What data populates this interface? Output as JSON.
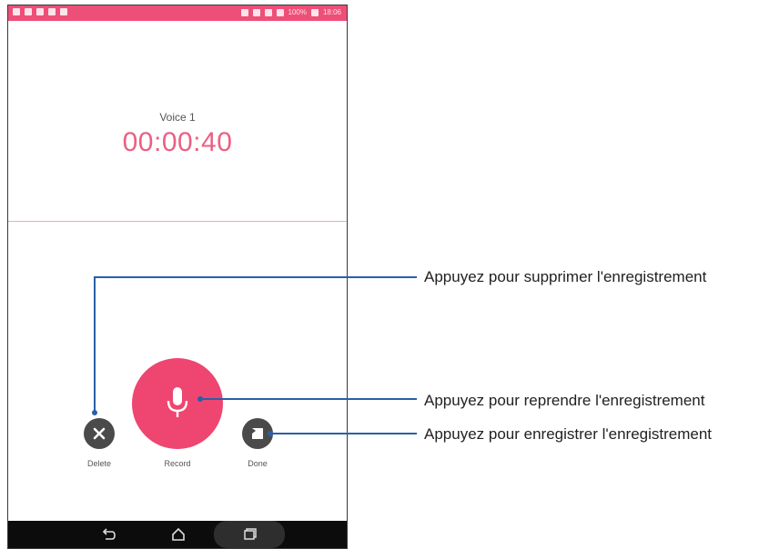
{
  "statusbar": {
    "battery": "100%",
    "time": "18:06"
  },
  "recording": {
    "title": "Voice 1",
    "timer": "00:00:40"
  },
  "controls": {
    "delete_label": "Delete",
    "record_label": "Record",
    "done_label": "Done"
  },
  "callouts": {
    "delete": "Appuyez pour supprimer l'enregistrement",
    "resume": "Appuyez pour reprendre l'enregistrement",
    "save": "Appuyez pour enregistrer l'enregistrement"
  },
  "colors": {
    "accent": "#ee4670",
    "statusbar": "#ee4f78",
    "timer": "#ec5f83",
    "button_dark": "#4a4a4a",
    "leader": "#2a5fa8"
  },
  "icons": {
    "record": "microphone-icon",
    "delete": "close-icon",
    "done": "stop-icon",
    "nav_back": "back-icon",
    "nav_home": "home-icon",
    "nav_recent": "recent-apps-icon"
  }
}
